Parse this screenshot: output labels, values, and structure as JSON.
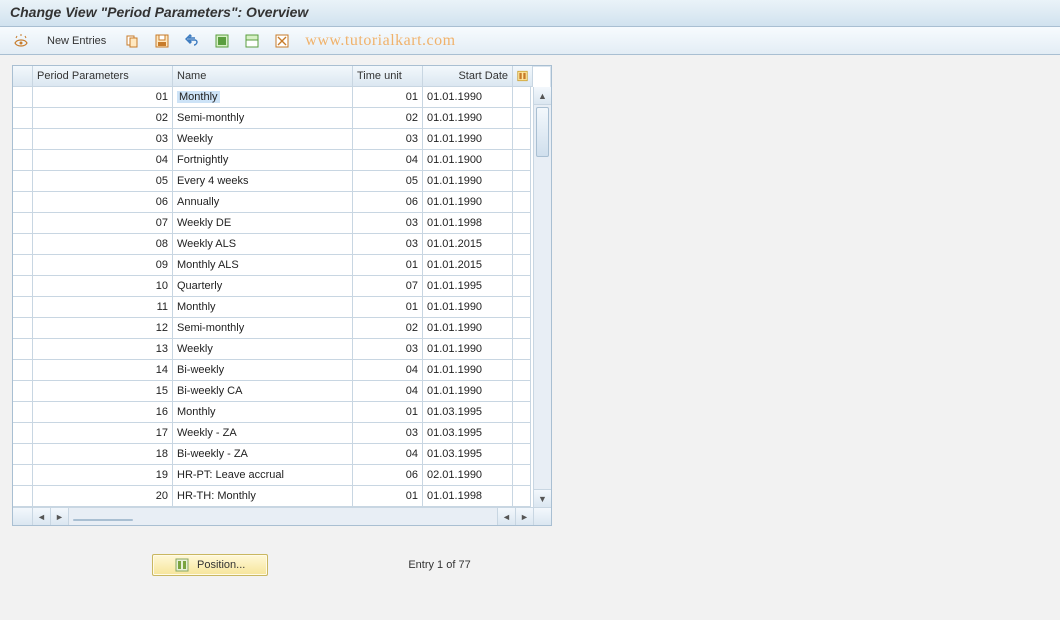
{
  "title": "Change View \"Period Parameters\": Overview",
  "toolbar": {
    "glasses_icon": "glasses",
    "new_entries": "New Entries",
    "icons": [
      "copy",
      "save",
      "undo",
      "select-all",
      "select-block",
      "deselect"
    ],
    "watermark": "www.tutorialkart.com"
  },
  "columns": {
    "period_param": "Period Parameters",
    "name": "Name",
    "time_unit": "Time unit",
    "start_date": "Start Date"
  },
  "rows": [
    {
      "param": "01",
      "name": "Monthly",
      "unit": "01",
      "date": "01.01.1990"
    },
    {
      "param": "02",
      "name": "Semi-monthly",
      "unit": "02",
      "date": "01.01.1990"
    },
    {
      "param": "03",
      "name": "Weekly",
      "unit": "03",
      "date": "01.01.1990"
    },
    {
      "param": "04",
      "name": "Fortnightly",
      "unit": "04",
      "date": "01.01.1900"
    },
    {
      "param": "05",
      "name": "Every 4 weeks",
      "unit": "05",
      "date": "01.01.1990"
    },
    {
      "param": "06",
      "name": "Annually",
      "unit": "06",
      "date": "01.01.1990"
    },
    {
      "param": "07",
      "name": "Weekly  DE",
      "unit": "03",
      "date": "01.01.1998"
    },
    {
      "param": "08",
      "name": "Weekly ALS",
      "unit": "03",
      "date": "01.01.2015"
    },
    {
      "param": "09",
      "name": "Monthly ALS",
      "unit": "01",
      "date": "01.01.2015"
    },
    {
      "param": "10",
      "name": "Quarterly",
      "unit": "07",
      "date": "01.01.1995"
    },
    {
      "param": "11",
      "name": "Monthly",
      "unit": "01",
      "date": "01.01.1990"
    },
    {
      "param": "12",
      "name": "Semi-monthly",
      "unit": "02",
      "date": "01.01.1990"
    },
    {
      "param": "13",
      "name": "Weekly",
      "unit": "03",
      "date": "01.01.1990"
    },
    {
      "param": "14",
      "name": "Bi-weekly",
      "unit": "04",
      "date": "01.01.1990"
    },
    {
      "param": "15",
      "name": "Bi-weekly CA",
      "unit": "04",
      "date": "01.01.1990"
    },
    {
      "param": "16",
      "name": "Monthly",
      "unit": "01",
      "date": "01.03.1995"
    },
    {
      "param": "17",
      "name": "Weekly - ZA",
      "unit": "03",
      "date": "01.03.1995"
    },
    {
      "param": "18",
      "name": "Bi-weekly - ZA",
      "unit": "04",
      "date": "01.03.1995"
    },
    {
      "param": "19",
      "name": "HR-PT: Leave accrual",
      "unit": "06",
      "date": "02.01.1990"
    },
    {
      "param": "20",
      "name": "HR-TH: Monthly",
      "unit": "01",
      "date": "01.01.1998"
    }
  ],
  "footer": {
    "position_btn": "Position...",
    "entry_label": "Entry 1 of 77"
  }
}
